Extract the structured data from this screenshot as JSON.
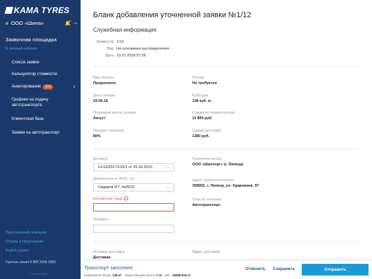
{
  "sidebar": {
    "logo": "KAMA TYRES",
    "org_name": "ООО «Шина»",
    "section_title": "Заявочная площадка",
    "section_subtitle": "В личный кабинет",
    "menu": [
      {
        "label": "Список заявок"
      },
      {
        "label": "Калькулятор стоимости"
      },
      {
        "label": "Анкетирование",
        "badge": "220"
      },
      {
        "label": "Графики на подачу автотранспорта"
      },
      {
        "label": "Клиентская база"
      },
      {
        "label": "Заявки на автотранспорт"
      }
    ],
    "footer_links": [
      "Персональный помощник",
      "Отзывы и предложения",
      "English version"
    ],
    "hotline": "Горячая линия 8 800 2000 0000",
    "copyright": "© КамаТайрс"
  },
  "main": {
    "title": "Бланк добавления уточненной заявки №1/12",
    "service_info_title": "Служебная информация",
    "meta": [
      {
        "label": "Заявка №",
        "value": "1/12"
      },
      {
        "label": "Вид",
        "value": "На основании распределения"
      },
      {
        "label": "Дата",
        "value": "10.07.2018 07:56"
      }
    ],
    "details_left": [
      {
        "label": "Вид оплаты",
        "value": "Предоплата"
      },
      {
        "label": "Дата оплаты",
        "value": "19.06.18"
      },
      {
        "label": "Плановый месяц заявки",
        "value": "Август"
      },
      {
        "label": "Процент загрузки",
        "value": "80%"
      }
    ],
    "details_right": [
      {
        "label": "Оплад",
        "value": "Не требуется"
      },
      {
        "label": "Кубатура",
        "value": "138 куб. м"
      },
      {
        "label": "Сумма по номенклатуре",
        "value": "11 800 руб."
      },
      {
        "label": "Сумма доставки",
        "value": "1380 руб."
      }
    ],
    "contract_label": "Договор",
    "contract_value": "12/12/2017/123/1 от 25.10.2010",
    "attorney_label": "Доверенность ФИО, №",
    "attorney_value": "Сидоров И.Г, №0010",
    "contact_label": "Контактное лицо",
    "phone_label": "Телефон",
    "consignee_label": "Грузополучатель",
    "consignee_value": "ООО «Шинторг» (г. Липецк)",
    "consignee_address_label": "Адрес грузополучателя",
    "consignee_address_value": "398902, г. Липецк, ул. Ударников, 97",
    "shipping_method_label": "Способ отгрузки",
    "shipping_method_value": "Автотранспорт",
    "delivery_terms_label": "Условия доставки",
    "delivery_terms_value": "Доставка",
    "delivery_address_label": "Адрес доставки"
  },
  "bottom_bar": {
    "title": "Транспорт заполнен",
    "stat1_label": "Набранный объем:",
    "stat1_value": "138 м³",
    "stat2_label": "Недостающий объем:",
    "stat2_value": "0 м³",
    "stat3_label": "Вес:",
    "stat3_value": "16668.915 кг",
    "cancel_label": "Отменить",
    "save_label": "Сохранить",
    "submit_label": "Отправить"
  },
  "colors": {
    "sidebar": "#1a3a6b",
    "accent": "#1a9ad6",
    "link": "#1f5ea8",
    "error": "#e0563a",
    "badge": "#e05a2b"
  }
}
